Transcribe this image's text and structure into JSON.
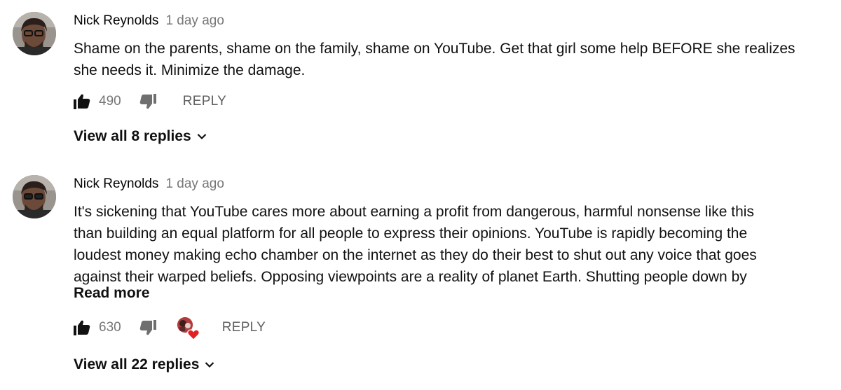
{
  "comments": [
    {
      "author": "Nick Reynolds",
      "time": "1 day ago",
      "lines": [
        "Shame on the parents, shame on the family, shame on YouTube.  Get that girl some help BEFORE she realizes",
        "she needs it.  Minimize the damage."
      ],
      "likes": "490",
      "reply_label": "REPLY",
      "view_replies": "View all 8 replies",
      "creator_heart": false
    },
    {
      "author": "Nick Reynolds",
      "time": "1 day ago",
      "lines": [
        "It's sickening that YouTube cares more about earning a profit from dangerous, harmful nonsense like this",
        "than building an equal platform for all people to express their opinions.  YouTube is rapidly becoming the",
        "loudest money making echo chamber on the internet as they do their best to shut out any voice that goes",
        "against their warped beliefs.  Opposing viewpoints are a reality of planet Earth.  Shutting people down by"
      ],
      "read_more": "Read more",
      "likes": "630",
      "reply_label": "REPLY",
      "view_replies": "View all 22 replies",
      "creator_heart": true
    }
  ],
  "icons": {
    "like": "thumb-up-icon",
    "dislike": "thumb-down-icon",
    "expand": "chevron-down-icon",
    "heart": "heart-icon"
  },
  "colors": {
    "text": "#111111",
    "secondary": "#767676",
    "heart": "#e22222"
  }
}
